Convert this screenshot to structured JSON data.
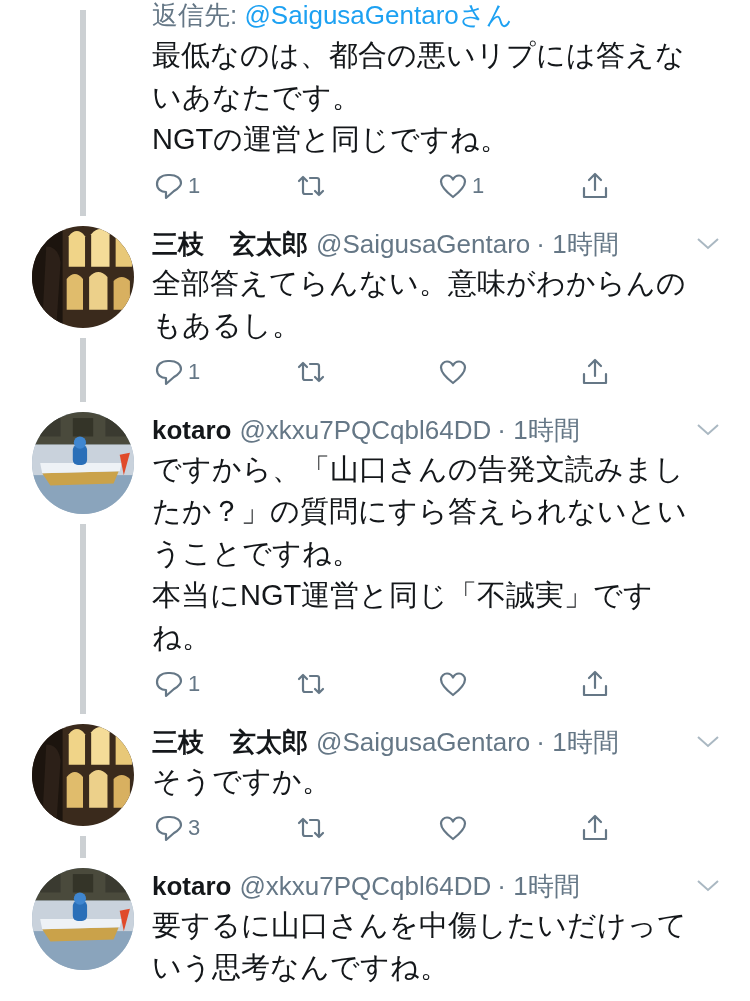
{
  "tweets": [
    {
      "reply_to": {
        "prefix": "返信先: ",
        "handle": "@SaigusaGentaroさん"
      },
      "body": [
        "最低なのは、都合の悪いリプには答えないあなたです。",
        "NGTの運営と同じですね。"
      ],
      "actions": {
        "replies": "1",
        "likes": "1"
      },
      "thread_line": true
    },
    {
      "name": "三枝　玄太郎",
      "handle": "@SaigusaGentaro",
      "time": "· 1時間",
      "body": [
        "全部答えてらんない。意味がわからんのもあるし。"
      ],
      "actions": {
        "replies": "1"
      },
      "thread_line": true
    },
    {
      "name": "kotaro",
      "handle": "@xkxu7PQCqbl64DD",
      "time": "· 1時間",
      "body": [
        "ですから、「山口さんの告発文読みましたか？」の質問にすら答えられないということですね。",
        "本当にNGT運営と同じ「不誠実」ですね。"
      ],
      "actions": {
        "replies": "1"
      },
      "thread_line": true
    },
    {
      "name": "三枝　玄太郎",
      "handle": "@SaigusaGentaro",
      "time": "· 1時間",
      "body": [
        "そうですか。"
      ],
      "actions": {
        "replies": "3"
      },
      "thread_line": true
    },
    {
      "name": "kotaro",
      "handle": "@xkxu7PQCqbl64DD",
      "time": "· 1時間",
      "body": [
        "要するに山口さんを中傷したいだけっていう思考なんですね。"
      ],
      "thread_line": false
    }
  ]
}
